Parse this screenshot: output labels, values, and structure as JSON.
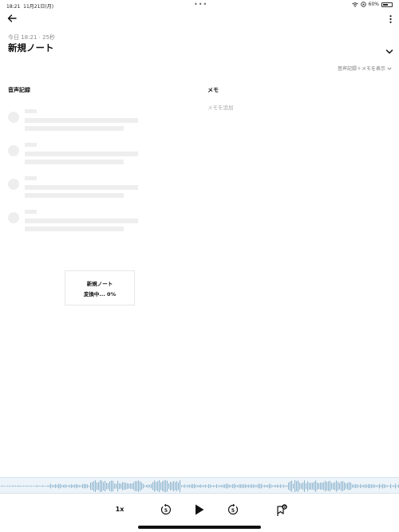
{
  "status_bar": {
    "time": "18:21",
    "date": "11月21日(月)",
    "battery": "60%"
  },
  "note": {
    "subtitle": "今日 18:21 · 25秒",
    "title": "新規ノート"
  },
  "view_toggle": {
    "label": "音声記録＋メモを表示"
  },
  "columns": {
    "transcript_header": "音声記録",
    "memo_header": "メモ",
    "memo_placeholder": "メモを追加"
  },
  "transcript_skeleton_rows": 4,
  "progress": {
    "title": "新規ノート",
    "status": "変換中... 0%",
    "value_percent": 0
  },
  "playback": {
    "speed_label": "1x",
    "rewind_seconds": "5",
    "forward_seconds": "5",
    "bookmark_count": "0"
  },
  "colors": {
    "waveform": "#8fb5cf",
    "waveform_bg": "#edf4f9",
    "skeleton": "#eeeeee",
    "muted_text": "#8b8b8b"
  }
}
